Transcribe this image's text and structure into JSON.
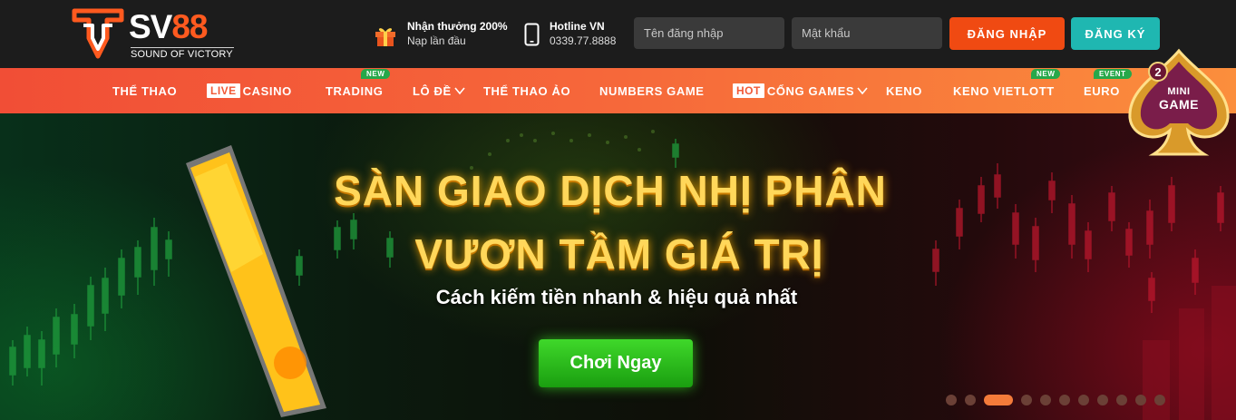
{
  "header": {
    "logo_brand": "SV",
    "logo_brand_num": "88",
    "logo_slogan": "SOUND OF VICTORY",
    "promo_title": "Nhận thưởng 200%",
    "promo_sub": "Nạp lần đầu",
    "hotline_title": "Hotline VN",
    "hotline_number": "0339.77.8888",
    "username_placeholder": "Tên đăng nhập",
    "password_placeholder": "Mật khẩu",
    "login_label": "ĐĂNG NHẬP",
    "register_label": "ĐĂNG KÝ"
  },
  "nav": {
    "items": [
      {
        "label": "THỂ THAO"
      },
      {
        "tag": "LIVE",
        "label": "CASINO"
      },
      {
        "label": "TRADING",
        "badge": "NEW"
      },
      {
        "label": "LÔ ĐỀ",
        "dropdown": true
      },
      {
        "label": "THỂ THAO ẢO"
      },
      {
        "label": "NUMBERS GAME"
      },
      {
        "tag": "HOT",
        "label": "CỔNG GAMES",
        "dropdown": true
      },
      {
        "label": "KENO"
      },
      {
        "label": "KENO VIETLOTT",
        "badge": "NEW"
      },
      {
        "label": "EURO",
        "badge": "EVENT"
      }
    ]
  },
  "hero": {
    "title_line1": "SÀN GIAO DỊCH NHỊ PHÂN",
    "title_line2": "VƯƠN TẦM GIÁ TRỊ",
    "subtitle": "Cách kiếm tiền nhanh & hiệu quả nhất",
    "cta_label": "Chơi Ngay",
    "slides_total": 11,
    "active_slide": 3
  },
  "minigame": {
    "count": "2",
    "line1": "MINI",
    "line2": "GAME"
  },
  "colors": {
    "accent_orange": "#f04a12",
    "teal": "#1fb7b1",
    "cta_green": "#2cc11c",
    "badge_green": "#26a84a"
  }
}
